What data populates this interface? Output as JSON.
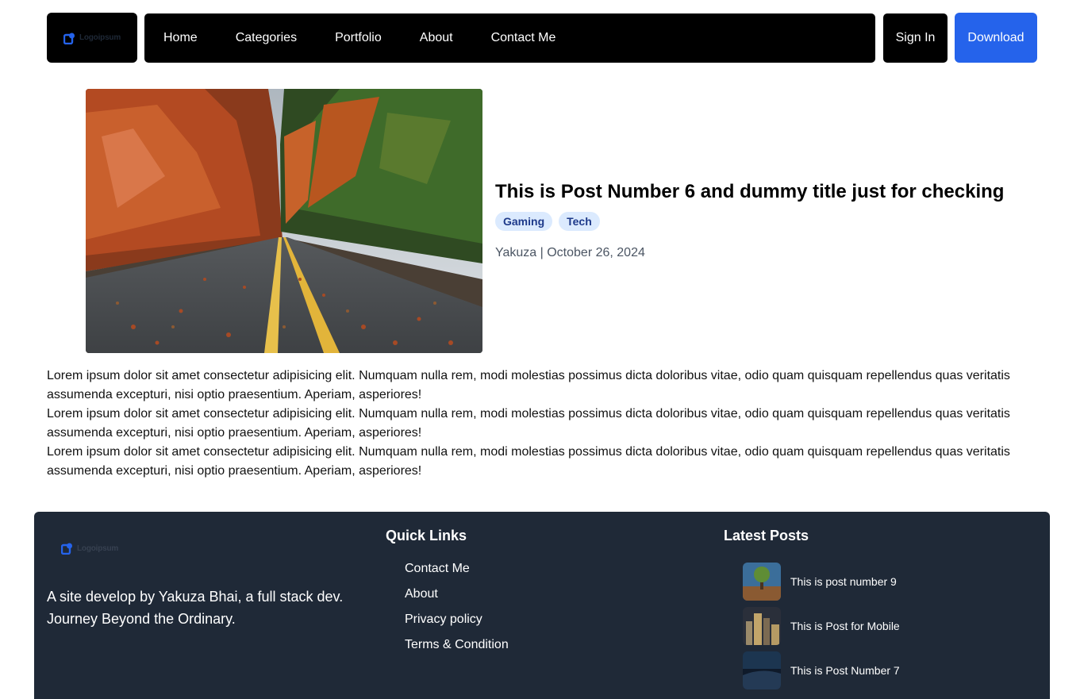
{
  "header": {
    "logo_text": "Logoipsum",
    "nav": [
      "Home",
      "Categories",
      "Portfolio",
      "About",
      "Contact Me"
    ],
    "signin_label": "Sign In",
    "download_label": "Download"
  },
  "post": {
    "title": "This is Post Number 6 and dummy title just for checking",
    "tags": [
      "Gaming",
      "Tech"
    ],
    "meta": "Yakuza | October 26, 2024",
    "paragraphs": [
      "Lorem ipsum dolor sit amet consectetur adipisicing elit. Numquam nulla rem, modi molestias possimus dicta doloribus vitae, odio quam quisquam repellendus quas veritatis assumenda excepturi, nisi optio praesentium. Aperiam, asperiores!",
      "Lorem ipsum dolor sit amet consectetur adipisicing elit. Numquam nulla rem, modi molestias possimus dicta doloribus vitae, odio quam quisquam repellendus quas veritatis assumenda excepturi, nisi optio praesentium. Aperiam, asperiores!",
      "Lorem ipsum dolor sit amet consectetur adipisicing elit. Numquam nulla rem, modi molestias possimus dicta doloribus vitae, odio quam quisquam repellendus quas veritatis assumenda excepturi, nisi optio praesentium. Aperiam, asperiores!"
    ]
  },
  "footer": {
    "logo_text": "Logoipsum",
    "description": "A site develop by Yakuza Bhai, a full stack dev. Journey Beyond the Ordinary.",
    "quick_links_heading": "Quick Links",
    "quick_links": [
      "Contact Me",
      "About",
      "Privacy policy",
      "Terms & Condition"
    ],
    "latest_heading": "Latest Posts",
    "latest_posts": [
      "This is post number 9",
      "This is Post for Mobile",
      "This is Post Number 7"
    ]
  },
  "colors": {
    "accent": "#2563eb",
    "footer_bg": "#1f2937",
    "tag_bg": "#dbeafe",
    "tag_text": "#1e3a8a"
  }
}
